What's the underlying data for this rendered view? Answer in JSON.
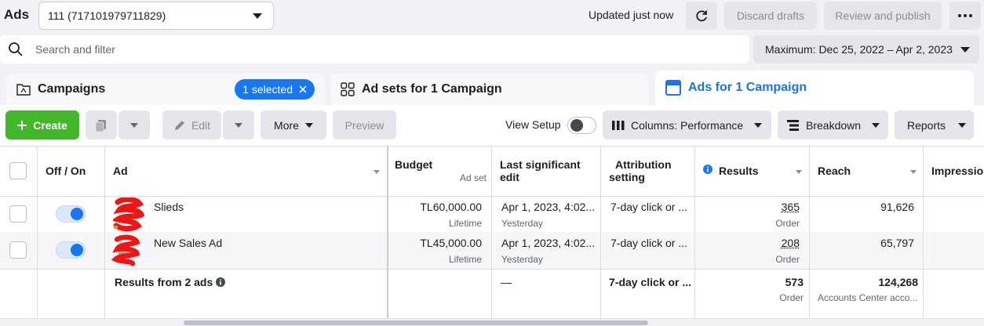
{
  "topbar": {
    "title": "Ads",
    "account": "111 (717101979711829)",
    "updated": "Updated just now",
    "discard_label": "Discard drafts",
    "review_label": "Review and publish"
  },
  "search": {
    "placeholder": "Search and filter",
    "date_range": "Maximum: Dec 25, 2022 – Apr 2, 2023"
  },
  "tabs": {
    "campaigns": "Campaigns",
    "selected": "1 selected",
    "adsets": "Ad sets for 1 Campaign",
    "ads": "Ads for 1 Campaign"
  },
  "toolbar": {
    "create": "Create",
    "edit": "Edit",
    "more": "More",
    "preview": "Preview",
    "view_setup": "View Setup",
    "columns": "Columns: Performance",
    "breakdown": "Breakdown",
    "reports": "Reports"
  },
  "table": {
    "headers": {
      "off_on": "Off / On",
      "ad": "Ad",
      "budget": "Budget",
      "budget_sub": "Ad set",
      "last_edit_1": "Last significant",
      "last_edit_2": "edit",
      "attribution_1": "Attribution",
      "attribution_2": "setting",
      "results": "Results",
      "reach": "Reach",
      "impressions": "Impressio"
    },
    "rows": [
      {
        "name": "Slieds",
        "budget": "TL60,000.00",
        "budget_type": "Lifetime",
        "last_edit": "Apr 1, 2023, 4:02...",
        "last_edit_rel": "Yesterday",
        "attribution": "7-day click or ...",
        "results": "365",
        "results_type": "Order",
        "reach": "91,626"
      },
      {
        "name": "New Sales Ad",
        "budget": "TL45,000.00",
        "budget_type": "Lifetime",
        "last_edit": "Apr 1, 2023, 4:02...",
        "last_edit_rel": "Yesterday",
        "attribution": "7-day click or ...",
        "results": "208",
        "results_type": "Order",
        "reach": "65,797"
      }
    ],
    "summary": {
      "label": "Results from 2 ads",
      "last_edit": "—",
      "attribution": "7-day click or ...",
      "results": "573",
      "results_type": "Order",
      "reach": "124,268",
      "reach_sub": "Accounts Center acco..."
    }
  },
  "colors": {
    "accent": "#1877f2",
    "create_green": "#42b72a",
    "tab_active_text": "#1b74e4"
  }
}
